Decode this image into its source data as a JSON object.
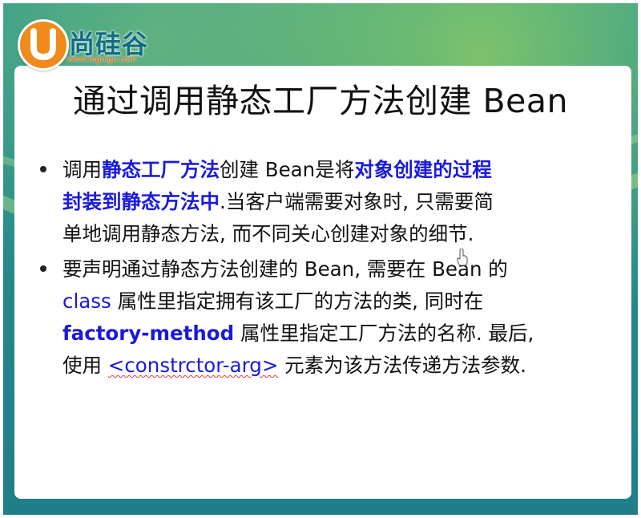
{
  "logo": {
    "brand_text": "尚硅谷",
    "url": "www.atguigu.com"
  },
  "slide": {
    "title": "通过调用静态工厂方法创建 Bean",
    "bullets": [
      {
        "lines": [
          [
            "调用",
            "静态工厂方法",
            "创建 Bean是将",
            "对象创建的过程"
          ],
          [
            "封装到静态方法中",
            ".当客户端需要对象时, 只需要简"
          ],
          [
            "单地调用静态方法, 而不同关心创建对象的细节."
          ]
        ]
      },
      {
        "lines": [
          [
            "要声明通过静态方法创建的 Bean, 需要在 Bean 的"
          ],
          [
            "class",
            " 属性里指定拥有该工厂的方法的类, 同时在"
          ],
          [
            "factory-method",
            " 属性里指定工厂方法的名称. 最后,"
          ],
          [
            "使用 ",
            "<constrctor-arg>",
            " 元素为该方法传递方法参数."
          ]
        ]
      }
    ]
  },
  "colors": {
    "highlight_blue": "#1a1adc",
    "background_teal": "#23888a",
    "logo_orange": "#f08a1a"
  }
}
